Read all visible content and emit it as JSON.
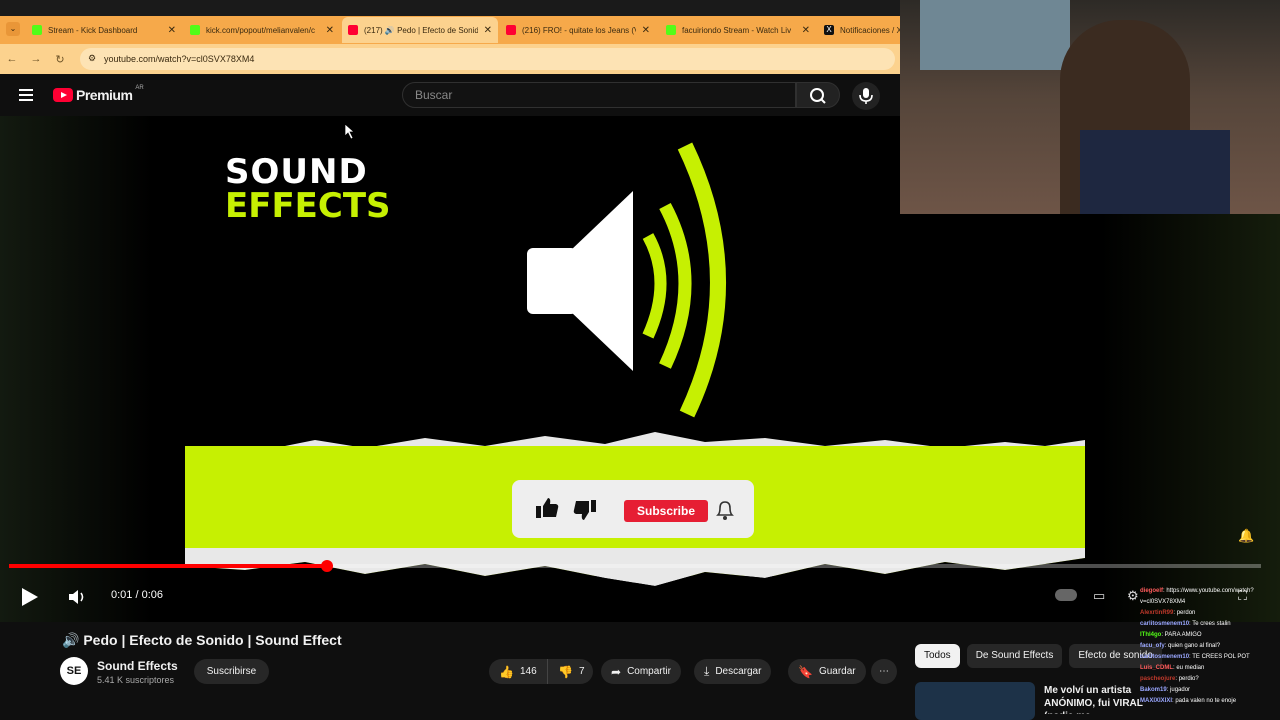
{
  "browser": {
    "tabs": [
      {
        "title": "Stream - Kick Dashboard",
        "color": "#53fc18",
        "active": false
      },
      {
        "title": "kick.com/popout/melianvalen/c",
        "color": "#53fc18",
        "active": false
      },
      {
        "title": "(217) 🔊 Pedo | Efecto de Sonid",
        "color": "#ff0033",
        "active": true
      },
      {
        "title": "(216) FRO! - quitate los Jeans (V",
        "color": "#ff0033",
        "active": false
      },
      {
        "title": "facuiriondo Stream - Watch Liv",
        "color": "#53fc18",
        "active": false
      },
      {
        "title": "Notificaciones / X",
        "color": "#111111",
        "active": false
      }
    ],
    "address": "youtube.com/watch?v=cl0SVX78XM4"
  },
  "youtube": {
    "logo_word": "Premium",
    "region": "AR",
    "search_placeholder": "Buscar"
  },
  "video_art": {
    "brand_line1": "SOUND",
    "brand_line2": "EFFECTS",
    "subscribe_label": "Subscribe"
  },
  "player": {
    "time": "0:01 / 0:06",
    "progress": 0.254
  },
  "video": {
    "title": "🔊 Pedo | Efecto de Sonido | Sound Effect",
    "channel_initials": "SE",
    "channel": "Sound Effects",
    "subscribers": "5.41 K suscriptores",
    "subscribe": "Suscribirse",
    "likes": "146",
    "dislikes": "7",
    "share": "Compartir",
    "download": "Descargar",
    "save": "Guardar"
  },
  "chips": [
    "Todos",
    "De Sound Effects",
    "Efecto de sonido"
  ],
  "recommendation": {
    "title": "Me volví un artista ANÓNIMO, fui VIRAL (nadie me"
  },
  "chat": [
    {
      "user": "diegoelf",
      "msg": ": https://www.youtube.com/watch?v=cl0SVX78XM4",
      "color": "#ff5c5c"
    },
    {
      "user": "AlexrtinR99",
      "msg": ": perdon",
      "color": "#c0392b"
    },
    {
      "user": "carlitosmenem10",
      "msg": ": Te crees stalin",
      "color": "#9aa7ff"
    },
    {
      "user": "IThl4go",
      "msg": ": PARA AMIGO",
      "color": "#53fc18"
    },
    {
      "user": "facu_ofy",
      "msg": ": quien gano al final?",
      "color": "#9aa7ff"
    },
    {
      "user": "carlitosmenem10",
      "msg": ": TE CREES POL POT",
      "color": "#9aa7ff"
    },
    {
      "user": "Luis_CDML",
      "msg": ": eu median",
      "color": "#ff5c5c"
    },
    {
      "user": "pascheojure",
      "msg": ": perdio?",
      "color": "#c0392b"
    },
    {
      "user": "Bakom19",
      "msg": ": jugador",
      "color": "#9aa7ff"
    },
    {
      "user": "MAXIXIXIXI",
      "msg": ": pada valen no te enoje",
      "color": "#9aa7ff"
    }
  ]
}
